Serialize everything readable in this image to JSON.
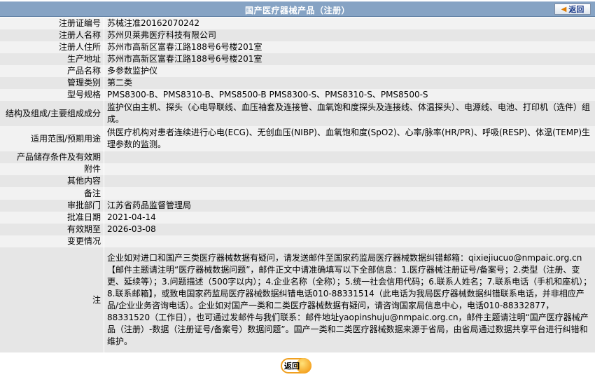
{
  "header": {
    "title": "国产医疗器械产品（注册）",
    "back_label": "返回"
  },
  "rows": [
    {
      "label": "注册证编号",
      "value": "苏械注准20162070242"
    },
    {
      "label": "注册人名称",
      "value": "苏州贝莱弗医疗科技有限公司"
    },
    {
      "label": "注册人住所",
      "value": "苏州市高新区富春江路188号6号楼201室"
    },
    {
      "label": "生产地址",
      "value": "苏州市高新区富春江路188号6号楼201室"
    },
    {
      "label": "产品名称",
      "value": "多参数监护仪"
    },
    {
      "label": "管理类别",
      "value": "第二类"
    },
    {
      "label": "型号规格",
      "value": "PMS8300-B、PMS8310-B、PMS8500-B PMS8300-S、PMS8310-S、PMS8500-S"
    },
    {
      "label": "结构及组成/主要组成成分",
      "value": "监护仪由主机、探头（心电导联线、血压袖套及连接管、血氧饱和度探头及连接线、体温探头）、电源线、电池、打印机（选件）组成。"
    },
    {
      "label": "适用范围/预期用途",
      "value": "供医疗机构对患者连续进行心电(ECG)、无创血压(NIBP)、血氧饱和度(SpO2)、心率/脉率(HR/PR)、呼吸(RESP)、体温(TEMP)生理参数的监测。"
    },
    {
      "label": "产品储存条件及有效期",
      "value": ""
    },
    {
      "label": "附件",
      "value": ""
    },
    {
      "label": "其他内容",
      "value": ""
    },
    {
      "label": "备注",
      "value": ""
    },
    {
      "label": "审批部门",
      "value": "江苏省药品监督管理局"
    },
    {
      "label": "批准日期",
      "value": "2021-04-14"
    },
    {
      "label": "有效期至",
      "value": "2026-03-08"
    },
    {
      "label": "变更情况",
      "value": ""
    }
  ],
  "note": {
    "label": "注",
    "text": "企业如对进口和国产三类医疗器械数据有疑问，请发送邮件至国家药监局医疗器械数据纠错邮箱：qixiejiucuo@nmpaic.org.cn【邮件主题请注明“医疗器械数据问题”，邮件正文中请准确填写以下全部信息：1.医疗器械注册证号/备案号；2.类型（注册、变更、延续等）；3.问题描述（500字以内）；4.企业名称（全称）；5.统一社会信用代码；6.联系人姓名；7.联系电话（手机和座机）；8.联系邮箱】，或致电国家药监局医疗器械数据纠错电话010-88331514（此电话为我局医疗器械数据纠错联系电话，并非相应产品/企业业务咨询电话）。企业如对国产一类和二类医疗器械数据有疑问，请咨询国家局信息中心，电话010-88332877，88331520（工作日），也可通过发邮件与我们联系：邮件地址yaopinshuju@nmpaic.org.cn，邮件主题请注明“国产医疗器械产品（注册）-数据（注册证号/备案号）数据问题”。国产一类和二类医疗器械数据来源于省局，由省局通过数据共享平台进行纠错和维护。"
  },
  "footer": {
    "back_label": "返回"
  }
}
